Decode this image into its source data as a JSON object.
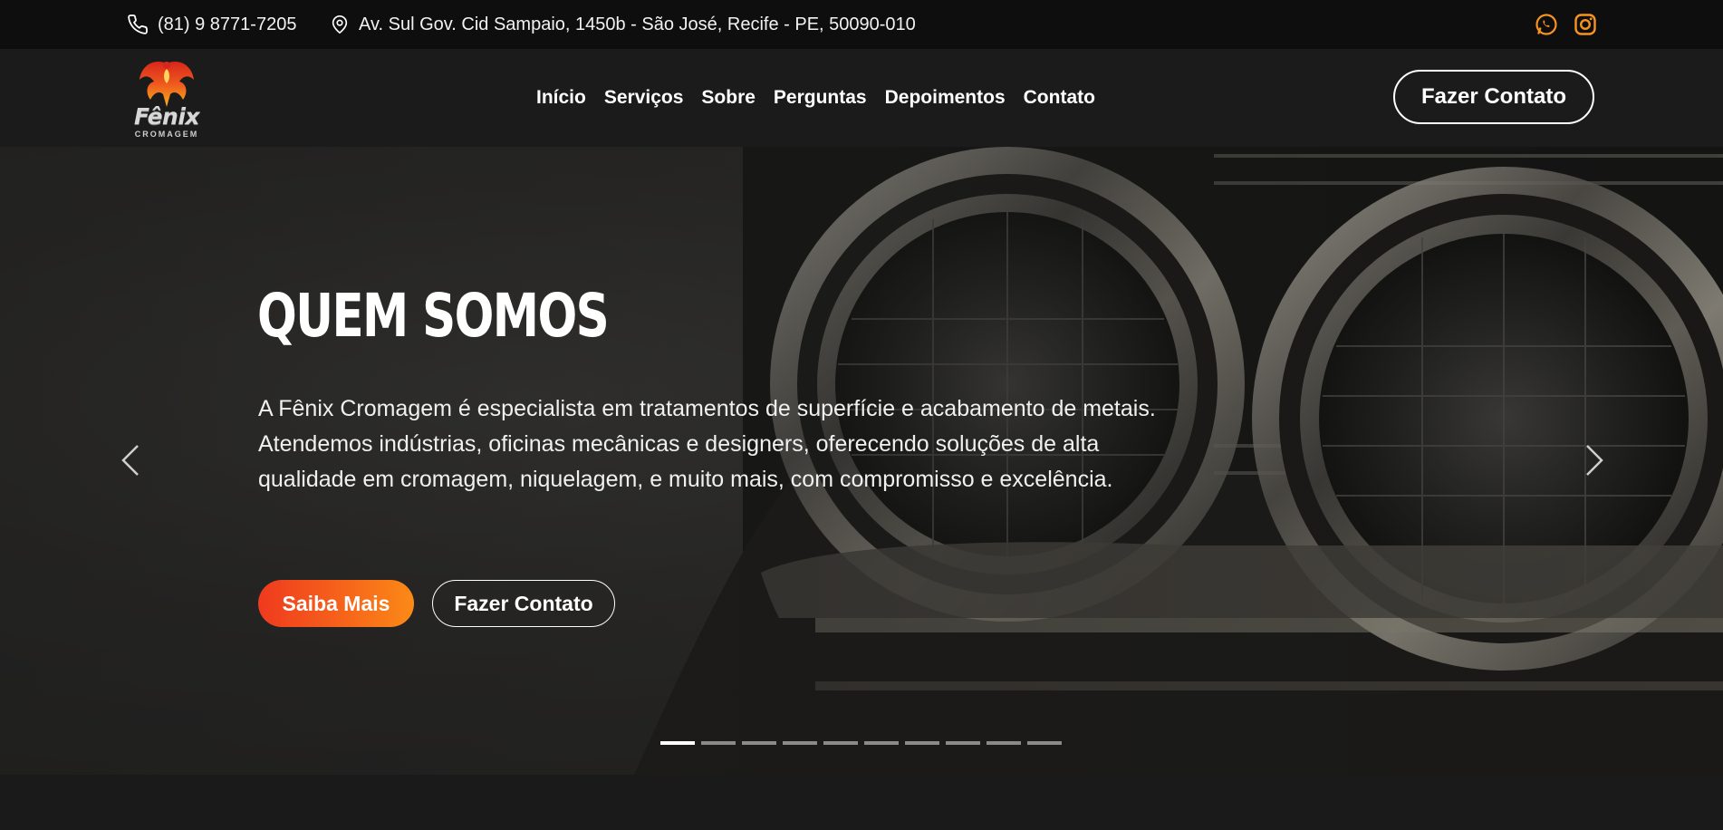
{
  "topbar": {
    "phone": "(81) 9 8771-7205",
    "address": "Av. Sul Gov. Cid Sampaio, 1450b - São José, Recife - PE, 50090-010",
    "phone_icon": "phone-icon",
    "location_icon": "location-pin-icon",
    "social_icons": [
      "whatsapp-icon",
      "instagram-icon"
    ],
    "social_color": "#f7931e"
  },
  "nav": {
    "logo_word": "Fênix",
    "logo_sub": "CROMAGEM",
    "links": [
      "Início",
      "Serviços",
      "Sobre",
      "Perguntas",
      "Depoimentos",
      "Contato"
    ],
    "cta": "Fazer Contato"
  },
  "hero": {
    "title": "QUEM SOMOS",
    "text": "A Fênix Cromagem é especialista em tratamentos de superfície e acabamento de metais. Atendemos indústrias, oficinas mecânicas e designers, oferecendo soluções de alta qualidade em cromagem, niquelagem, e muito mais, com compromisso e excelência.",
    "primary_button": "Saiba Mais",
    "secondary_button": "Fazer Contato",
    "slide_count": 10,
    "active_slide": 1,
    "accent_gradient": [
      "#ef3a1f",
      "#fb8a17"
    ]
  }
}
